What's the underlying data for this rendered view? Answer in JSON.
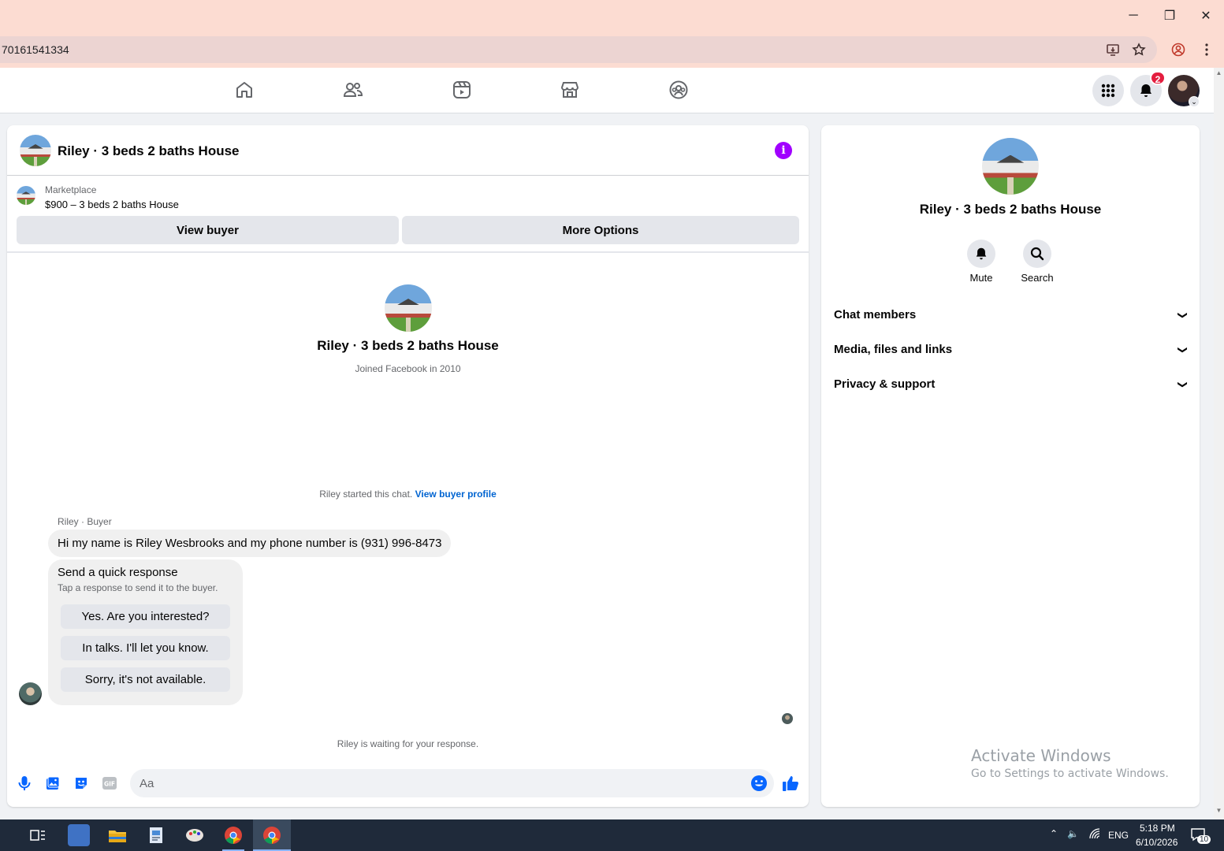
{
  "browser": {
    "url": "70161541334",
    "window_controls": {
      "minimize": "─",
      "restore": "❐",
      "close": "✕"
    }
  },
  "fb_nav": {
    "tabs": [
      "home",
      "friends",
      "video",
      "marketplace",
      "groups"
    ],
    "notifications_count": "2"
  },
  "chat": {
    "title": "Riley · 3 beds 2 baths House",
    "marketplace_label": "Marketplace",
    "listing": "$900 – 3 beds 2 baths House",
    "view_buyer": "View buyer",
    "more_options": "More Options",
    "profile_name": "Riley · 3 beds 2 baths House",
    "joined": "Joined Facebook in 2010",
    "started_text": "Riley started this chat.",
    "started_link": "View buyer profile",
    "sender_label": "Riley · Buyer",
    "message": "Hi my name is Riley Wesbrooks and my phone number is (931) 996-8473",
    "quick_title": "Send a quick response",
    "quick_sub": "Tap a response to send it to the buyer.",
    "quick_replies": [
      "Yes. Are you interested?",
      "In talks. I'll let you know.",
      "Sorry, it's not available."
    ],
    "waiting": "Riley is waiting for your response.",
    "composer_placeholder": "Aa"
  },
  "side": {
    "name": "Riley · 3 beds 2 baths House",
    "mute": "Mute",
    "search": "Search",
    "sections": [
      "Chat members",
      "Media, files and links",
      "Privacy & support"
    ]
  },
  "watermark": {
    "line1": "Activate Windows",
    "line2": "Go to Settings to activate Windows."
  },
  "taskbar": {
    "time": "5:18 PM",
    "date": "6/10/2026",
    "lang": "ENG",
    "notif_count": "10"
  },
  "colors": {
    "accent": "#0866ff",
    "info": "#a100ff",
    "badge": "#e41e3f"
  }
}
